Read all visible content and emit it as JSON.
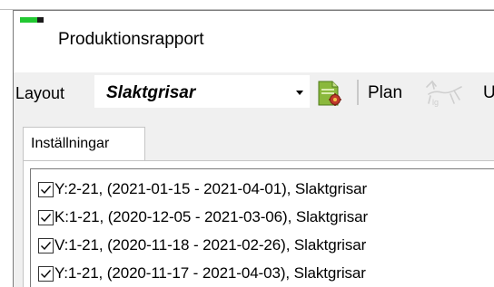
{
  "window": {
    "title": "Produktionsrapport"
  },
  "toolbar": {
    "layout_label": "Layout",
    "layout_value": "Slaktgrisar",
    "plan_label": "Plan",
    "cut_label": "U"
  },
  "tabs": [
    {
      "label": "Inställningar",
      "selected": true
    }
  ],
  "list": {
    "items": [
      {
        "label": "Y:2-21, (2021-01-15 - 2021-04-01), Slaktgrisar",
        "checked": true
      },
      {
        "label": "K:1-21, (2020-12-05 - 2021-03-06), Slaktgrisar",
        "checked": true
      },
      {
        "label": "V:1-21, (2020-11-18 - 2021-02-26), Slaktgrisar",
        "checked": true
      },
      {
        "label": "Y:1-21, (2020-11-17 - 2021-04-03), Slaktgrisar",
        "checked": true
      }
    ]
  },
  "icons": {
    "app": "app-icon",
    "dropdown": "chevron-down-icon",
    "report_doc": "report-document-icon",
    "pig": "pig-icon",
    "check": "checkmark-icon"
  },
  "colors": {
    "accent_green": "#22c832",
    "toolbar_bg": "#f0f0f0",
    "window_bg": "#ffffff"
  }
}
